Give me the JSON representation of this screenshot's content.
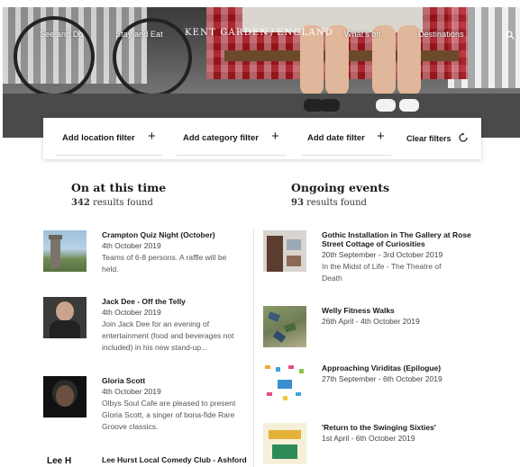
{
  "nav": {
    "items": [
      "See and Do",
      "Stay and Eat",
      "What's on",
      "Destinations"
    ],
    "brand_left": "KENT GARDEN",
    "brand_sep": "/",
    "brand_right": "ENGLAND",
    "search_icon": "search-icon"
  },
  "filters": {
    "location": "Add location filter",
    "category": "Add category filter",
    "date": "Add date filter",
    "plus": "+",
    "clear": "Clear filters",
    "clear_icon": "refresh-icon"
  },
  "on_at_this_time": {
    "heading": "On at this time",
    "count": "342",
    "count_suffix": "results found",
    "events": [
      {
        "title": "Crampton Quiz Night (October)",
        "date": "4th October 2019",
        "desc": [
          "Teams of 6-8 persons. A raffle will be",
          "held."
        ]
      },
      {
        "title": "Jack Dee - Off the Telly",
        "date": "4th October 2019",
        "desc": [
          "Join Jack Dee for an evening of",
          "entertainment (food and beverages not",
          "included) in his new stand-up..."
        ]
      },
      {
        "title": "Gloria Scott",
        "date": "4th October 2019",
        "desc": [
          "Olbys Soul Cafe are pleased to present",
          "Gloria Scott, a singer of bona-fide Rare",
          "Groove classics."
        ]
      },
      {
        "title": "Lee Hurst Local Comedy Club - Ashford",
        "date": "",
        "desc": []
      }
    ]
  },
  "ongoing": {
    "heading": "Ongoing events",
    "count": "93",
    "count_suffix": "results found",
    "events": [
      {
        "title": [
          "Gothic Installation in The Gallery at Rose",
          "Street Cottage of Curiosities"
        ],
        "date": "20th September - 3rd October 2019",
        "desc": [
          "In the Midst of Life - The Theatre of",
          "Death"
        ]
      },
      {
        "title": [
          "Welly Fitness Walks"
        ],
        "date": "26th April - 4th October 2019",
        "desc": []
      },
      {
        "title": [
          "Approaching Viriditas (Epilogue)"
        ],
        "date": "27th September - 6th October 2019",
        "desc": []
      },
      {
        "title": [
          "'Return to the Swinging Sixties'"
        ],
        "date": "1st April - 6th October 2019",
        "desc": []
      }
    ]
  },
  "thumb_text": "Lee H"
}
